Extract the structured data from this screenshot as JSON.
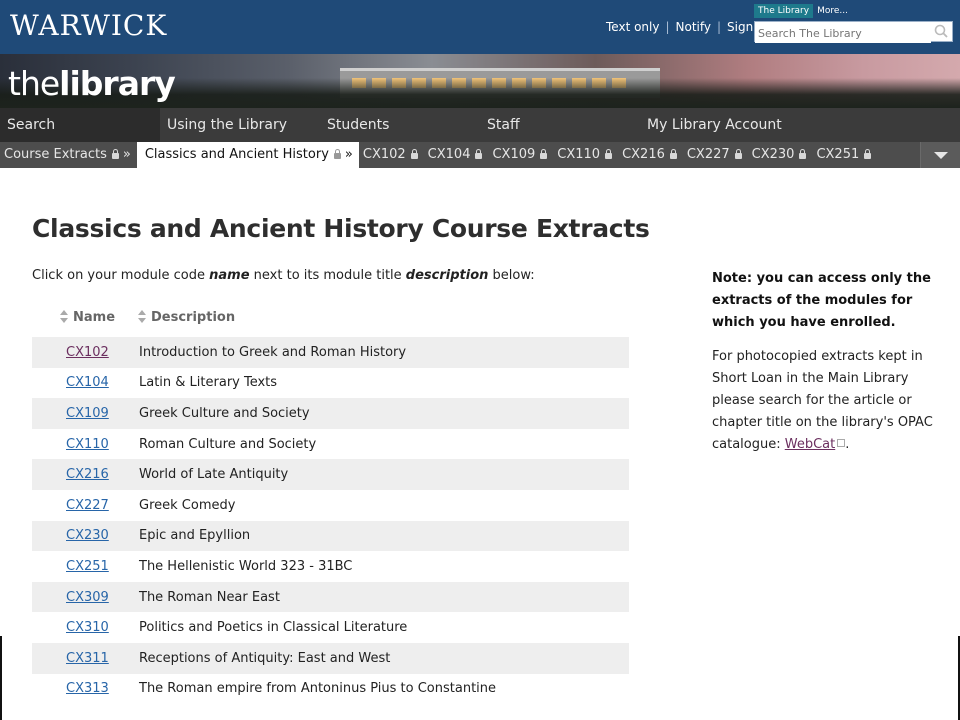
{
  "header": {
    "logo": "WARWICK",
    "links": [
      "Text only",
      "Notify",
      "Sign out"
    ],
    "search_tabs": [
      "The Library",
      "More..."
    ],
    "search_placeholder": "Search The Library"
  },
  "banner": {
    "brand_light": "the",
    "brand_bold": "library"
  },
  "main_nav": [
    "Search",
    "Using the Library",
    "Students",
    "Staff",
    "My Library Account"
  ],
  "sub_nav": {
    "parent": "Course Extracts",
    "current": "Classics and Ancient History",
    "modules": [
      "CX102",
      "CX104",
      "CX109",
      "CX110",
      "CX216",
      "CX227",
      "CX230",
      "CX251"
    ],
    "separator": "»"
  },
  "content": {
    "title": "Classics and Ancient History Course Extracts",
    "intro_pre": "Click on your module code ",
    "intro_name": "name",
    "intro_mid": " next to its module title ",
    "intro_desc": "description",
    "intro_post": " below:",
    "col_name": "Name",
    "col_desc": "Description",
    "rows": [
      {
        "code": "CX102",
        "desc": "Introduction to Greek and Roman History"
      },
      {
        "code": "CX104",
        "desc": "Latin & Literary Texts"
      },
      {
        "code": "CX109",
        "desc": "Greek Culture and Society"
      },
      {
        "code": "CX110",
        "desc": "Roman Culture and Society"
      },
      {
        "code": "CX216",
        "desc": "World of Late Antiquity"
      },
      {
        "code": "CX227",
        "desc": "Greek Comedy"
      },
      {
        "code": "CX230",
        "desc": "Epic and Epyllion"
      },
      {
        "code": "CX251",
        "desc": "The Hellenistic World 323 - 31BC"
      },
      {
        "code": "CX309",
        "desc": "The Roman Near East"
      },
      {
        "code": "CX310",
        "desc": "Politics and Poetics in Classical Literature"
      },
      {
        "code": "CX311",
        "desc": "Receptions of Antiquity: East and West"
      },
      {
        "code": "CX313",
        "desc": "The Roman empire from Antoninus Pius to Constantine"
      }
    ]
  },
  "note": {
    "strong": "Note: you can access only the extracts of the modules for which you have enrolled.",
    "text_pre": "For photocopied extracts kept in Short Loan in the Main Library please search for the article or chapter title on the library's OPAC catalogue: ",
    "link": "WebCat",
    "text_post": "."
  }
}
